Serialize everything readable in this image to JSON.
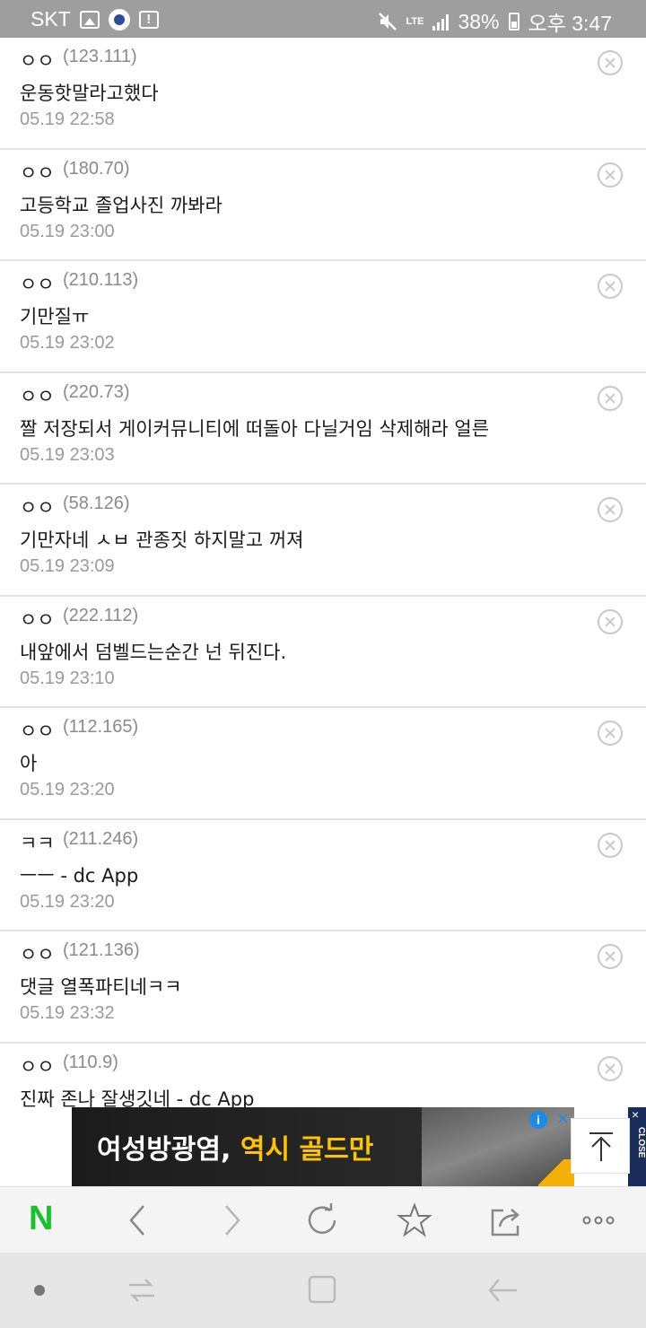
{
  "status_bar": {
    "carrier": "SKT",
    "network": "LTE",
    "battery": "38%",
    "time": "오후 3:47",
    "icons": [
      "image-icon",
      "app-badge-icon",
      "alert-icon",
      "mute-icon",
      "signal-icon",
      "battery-icon"
    ]
  },
  "comments": [
    {
      "nick": "ㅇㅇ",
      "ip": "(123.111)",
      "text": "운동핫말라고했다",
      "date": "05.19 22:58"
    },
    {
      "nick": "ㅇㅇ",
      "ip": "(180.70)",
      "text": "고등학교 졸업사진 까봐라",
      "date": "05.19 23:00"
    },
    {
      "nick": "ㅇㅇ",
      "ip": "(210.113)",
      "text": "기만질ㅠ",
      "date": "05.19 23:02"
    },
    {
      "nick": "ㅇㅇ",
      "ip": "(220.73)",
      "text": "짤 저장되서 게이커뮤니티에 떠돌아 다닐거임 삭제해라 얼른",
      "date": "05.19 23:03"
    },
    {
      "nick": "ㅇㅇ",
      "ip": "(58.126)",
      "text": "기만자네 ㅅㅂ 관종짓 하지말고 꺼져",
      "date": "05.19 23:09"
    },
    {
      "nick": "ㅇㅇ",
      "ip": "(222.112)",
      "text": "내앞에서 덤벨드는순간 넌 뒤진다.",
      "date": "05.19 23:10"
    },
    {
      "nick": "ㅇㅇ",
      "ip": "(112.165)",
      "text": "아",
      "date": "05.19 23:20"
    },
    {
      "nick": "ㅋㅋ",
      "ip": "(211.246)",
      "text": "ㅡㅡ - dc App",
      "date": "05.19 23:20"
    },
    {
      "nick": "ㅇㅇ",
      "ip": "(121.136)",
      "text": "댓글 열폭파티네ㅋㅋ",
      "date": "05.19 23:32"
    },
    {
      "nick": "ㅇㅇ",
      "ip": "(110.9)",
      "text": "진짜 존나 잘생깃네 - dc App",
      "date": ""
    }
  ],
  "ad": {
    "text_main": "여성방광염, ",
    "text_highlight": "역시 골드만",
    "info": "i",
    "close": "×",
    "side_close_label": "CLOSE",
    "side_x": "×"
  },
  "toolbar": {
    "home_label": "N",
    "home_color": "#19c22c",
    "buttons": [
      "back-icon",
      "forward-icon",
      "reload-icon",
      "bookmark-icon",
      "share-icon",
      "more-icon"
    ]
  }
}
